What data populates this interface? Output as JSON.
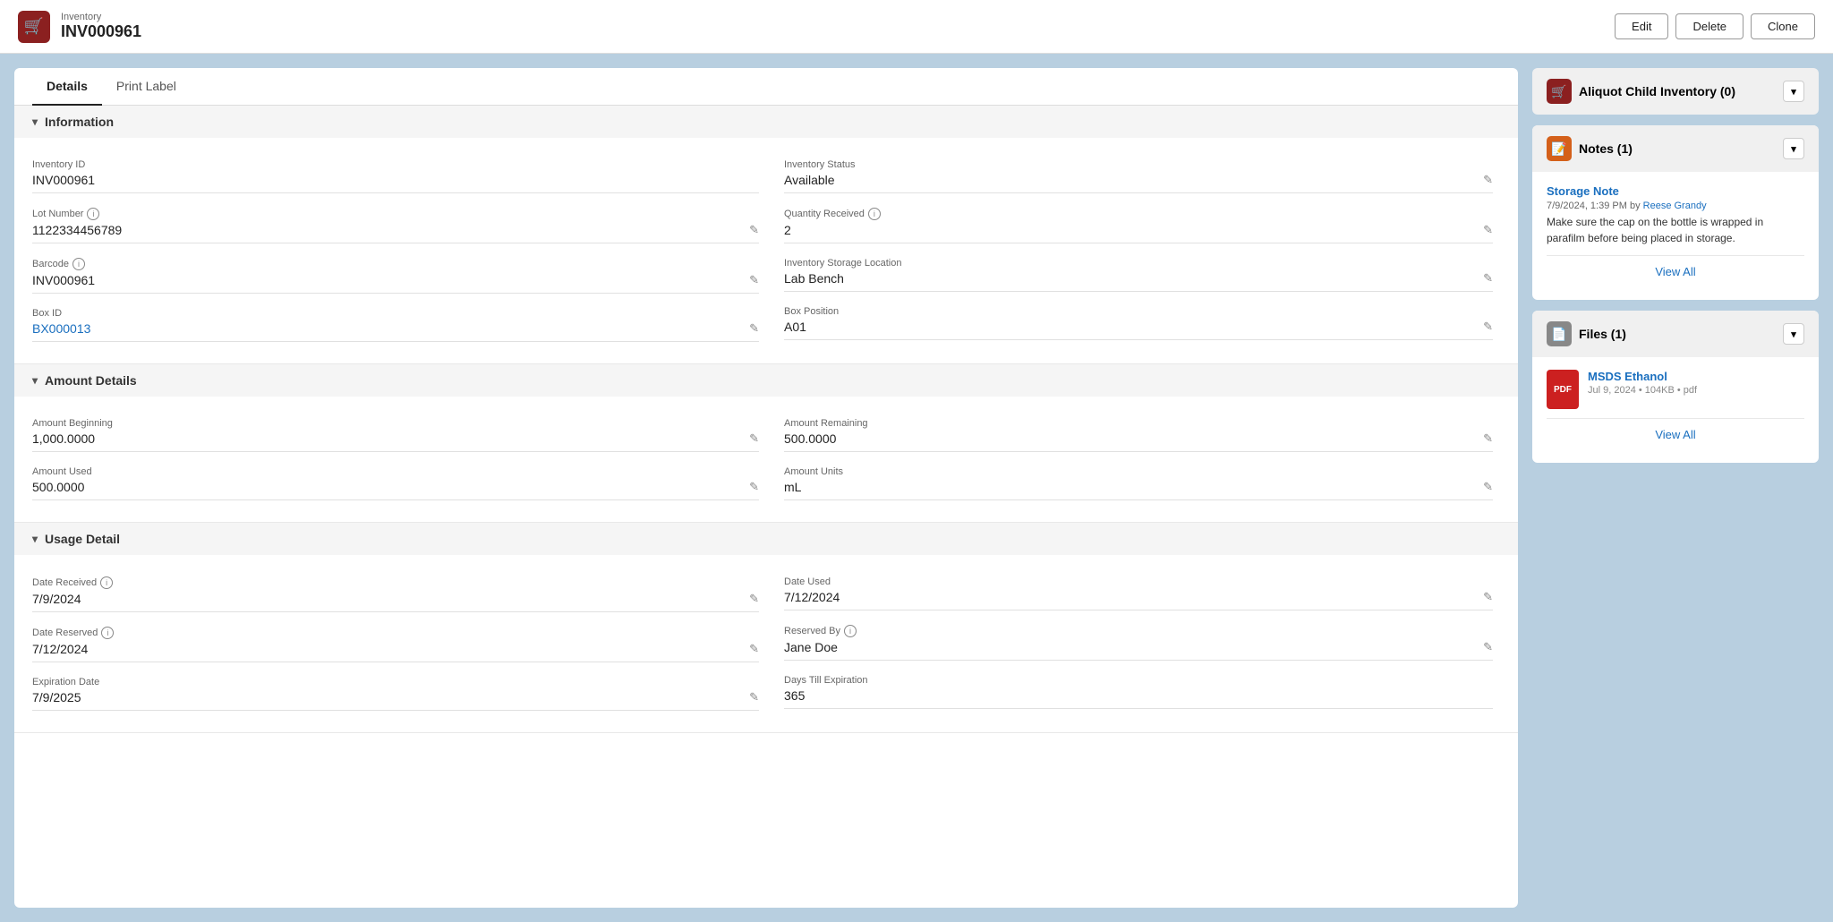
{
  "header": {
    "app_label": "Inventory",
    "record_id": "INV000961",
    "icon": "🛒",
    "buttons": {
      "edit": "Edit",
      "delete": "Delete",
      "clone": "Clone"
    }
  },
  "tabs": [
    {
      "id": "details",
      "label": "Details",
      "active": true
    },
    {
      "id": "print-label",
      "label": "Print Label",
      "active": false
    }
  ],
  "sections": {
    "information": {
      "title": "Information",
      "fields": {
        "inventory_id_label": "Inventory ID",
        "inventory_id_value": "INV000961",
        "inventory_status_label": "Inventory Status",
        "inventory_status_value": "Available",
        "lot_number_label": "Lot Number",
        "lot_number_value": "1122334456789",
        "quantity_received_label": "Quantity Received",
        "quantity_received_value": "2",
        "barcode_label": "Barcode",
        "barcode_value": "INV000961",
        "inventory_storage_location_label": "Inventory Storage Location",
        "inventory_storage_location_value": "Lab Bench",
        "box_id_label": "Box ID",
        "box_id_value": "BX000013",
        "box_position_label": "Box Position",
        "box_position_value": "A01"
      }
    },
    "amount_details": {
      "title": "Amount Details",
      "fields": {
        "amount_beginning_label": "Amount Beginning",
        "amount_beginning_value": "1,000.0000",
        "amount_remaining_label": "Amount Remaining",
        "amount_remaining_value": "500.0000",
        "amount_used_label": "Amount Used",
        "amount_used_value": "500.0000",
        "amount_units_label": "Amount Units",
        "amount_units_value": "mL"
      }
    },
    "usage_detail": {
      "title": "Usage Detail",
      "fields": {
        "date_received_label": "Date Received",
        "date_received_value": "7/9/2024",
        "date_used_label": "Date Used",
        "date_used_value": "7/12/2024",
        "date_reserved_label": "Date Reserved",
        "date_reserved_value": "7/12/2024",
        "reserved_by_label": "Reserved By",
        "reserved_by_value": "Jane Doe",
        "expiration_date_label": "Expiration Date",
        "expiration_date_value": "7/9/2025",
        "days_till_expiration_label": "Days Till Expiration",
        "days_till_expiration_value": "365"
      }
    }
  },
  "right_panel": {
    "aliquot": {
      "title": "Aliquot Child Inventory (0)"
    },
    "notes": {
      "title": "Notes (1)",
      "note_title": "Storage Note",
      "note_meta": "7/9/2024, 1:39 PM by",
      "note_author": "Reese Grandy",
      "note_text": "Make sure the cap on the bottle is wrapped in parafilm before being placed in storage.",
      "view_all": "View All"
    },
    "files": {
      "title": "Files (1)",
      "file_name": "MSDS Ethanol",
      "file_meta": "Jul 9, 2024  •  104KB  •  pdf",
      "pdf_label": "PDF",
      "view_all": "View All"
    }
  },
  "icons": {
    "pencil": "✎",
    "chevron_down": "▾",
    "info": "i"
  }
}
